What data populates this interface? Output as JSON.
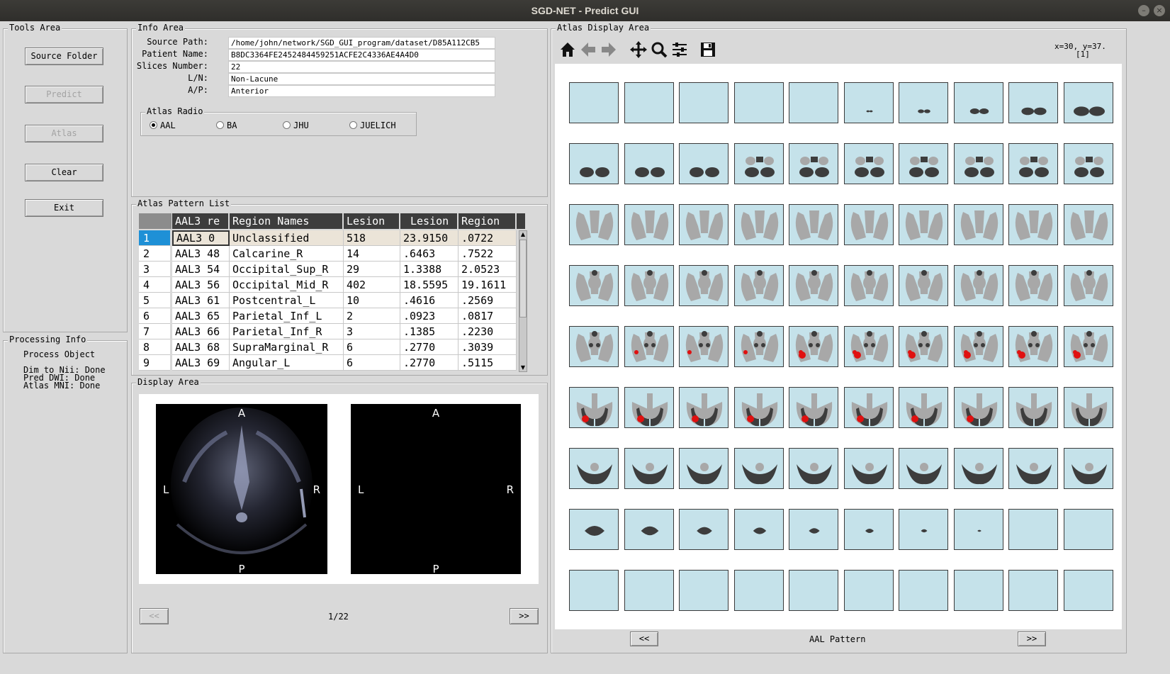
{
  "window": {
    "title": "SGD-NET - Predict GUI"
  },
  "tools": {
    "label": "Tools Area",
    "source_folder": "Source Folder",
    "predict": "Predict",
    "atlas": "Atlas",
    "clear": "Clear",
    "exit": "Exit"
  },
  "processing": {
    "label": "Processing Info",
    "title": "Process Object",
    "lines": [
      "Dim to Nii: Done",
      "Pred DWI: Done",
      "Atlas MNI: Done"
    ]
  },
  "info": {
    "label": "Info Area",
    "source_path_label": "Source Path:",
    "source_path": "/home/john/network/SGD_GUI_program/dataset/D85A112CB5",
    "patient_name_label": "Patient Name:",
    "patient_name": "B8DC3364FE2452484459251ACFE2C4336AE4A4D0",
    "slices_label": "Slices Number:",
    "slices": "22",
    "ln_label": "L/N:",
    "ln": "Non-Lacune",
    "ap_label": "A/P:",
    "ap": "Anterior",
    "atlas_radio_label": "Atlas Radio",
    "radios": [
      "AAL",
      "BA",
      "JHU",
      "JUELICH"
    ],
    "radio_selected": "AAL"
  },
  "pattern_list": {
    "label": "Atlas Pattern List",
    "headers": [
      "AAL3 re",
      "Region Names",
      "Lesion",
      "Lesion",
      "Region"
    ],
    "rows": [
      [
        "1",
        "AAL3 0",
        "Unclassified",
        "518",
        "23.9150",
        ".0722"
      ],
      [
        "2",
        "AAL3 48",
        "Calcarine_R",
        "14",
        ".6463",
        ".7522"
      ],
      [
        "3",
        "AAL3 54",
        "Occipital_Sup_R",
        "29",
        "1.3388",
        "2.0523"
      ],
      [
        "4",
        "AAL3 56",
        "Occipital_Mid_R",
        "402",
        "18.5595",
        "19.1611"
      ],
      [
        "5",
        "AAL3 61",
        "Postcentral_L",
        "10",
        ".4616",
        ".2569"
      ],
      [
        "6",
        "AAL3 65",
        "Parietal_Inf_L",
        "2",
        ".0923",
        ".0817"
      ],
      [
        "7",
        "AAL3 66",
        "Parietal_Inf_R",
        "3",
        ".1385",
        ".2230"
      ],
      [
        "8",
        "AAL3 68",
        "SupraMarginal_R",
        "6",
        ".2770",
        ".3039"
      ],
      [
        "9",
        "AAL3 69",
        "Angular_L",
        "6",
        ".2770",
        ".5115"
      ]
    ]
  },
  "display": {
    "label": "Display Area",
    "left_image": {
      "top": "A",
      "bottom": "P",
      "left": "L",
      "right": "R"
    },
    "right_image": {
      "top": "A",
      "bottom": "P",
      "left": "L",
      "right": "R"
    },
    "prev": "<<",
    "next": ">>",
    "page": "1/22"
  },
  "atlas_display": {
    "label": "Atlas Display Area",
    "coords": "x=30, y=37.",
    "coords_sub": "[1]",
    "prev": "<<",
    "next": ">>",
    "pattern_label": "AAL Pattern",
    "toolbar_icons": [
      "home-icon",
      "back-arrow-icon",
      "forward-arrow-icon",
      "pan-icon",
      "zoom-icon",
      "configure-icon",
      "save-icon"
    ],
    "colors": {
      "tile_bg": "#c5e2ea",
      "dark": "#3d3d3d",
      "light": "#a8a8a8",
      "lesion": "#e01010"
    }
  }
}
